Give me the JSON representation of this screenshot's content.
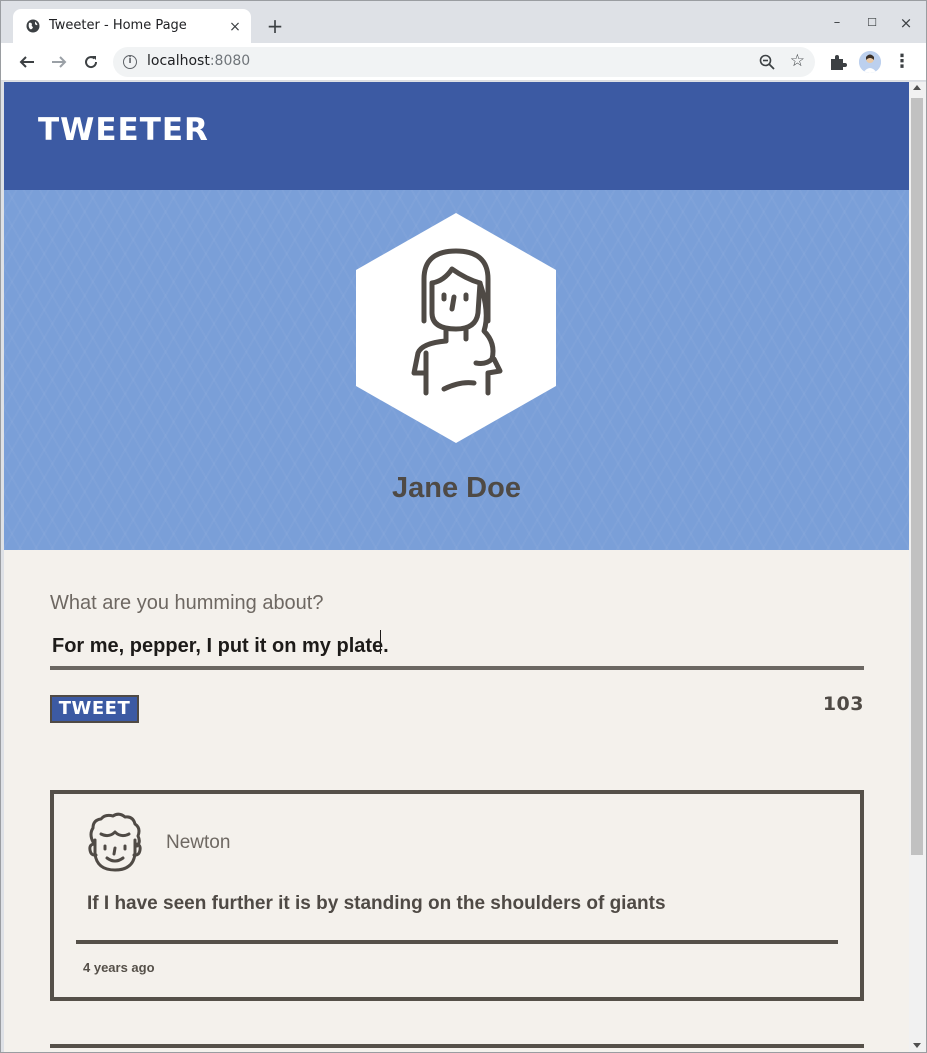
{
  "browser": {
    "tab_title": "Tweeter - Home Page",
    "tab_close": "×",
    "new_tab": "+",
    "url_host": "localhost",
    "url_port": ":8080",
    "window_controls": {
      "minimize": "–",
      "maximize": "☐",
      "close": "×"
    }
  },
  "header": {
    "logo": "Tweeter"
  },
  "profile": {
    "name": "Jane Doe"
  },
  "compose": {
    "label": "What are you humming about?",
    "value": "For me, pepper, I put it on my plate.",
    "tweet_button": "Tweet",
    "counter": "103"
  },
  "tweets": [
    {
      "author": "Newton",
      "text": "If I have seen further it is by standing on the shoulders of giants",
      "time": "4 years ago"
    }
  ],
  "colors": {
    "header_bg": "#3c5aa3",
    "hero_bg": "#7a9fd8",
    "page_bg": "#f4f1ec",
    "text_dark": "#4f4a45"
  }
}
